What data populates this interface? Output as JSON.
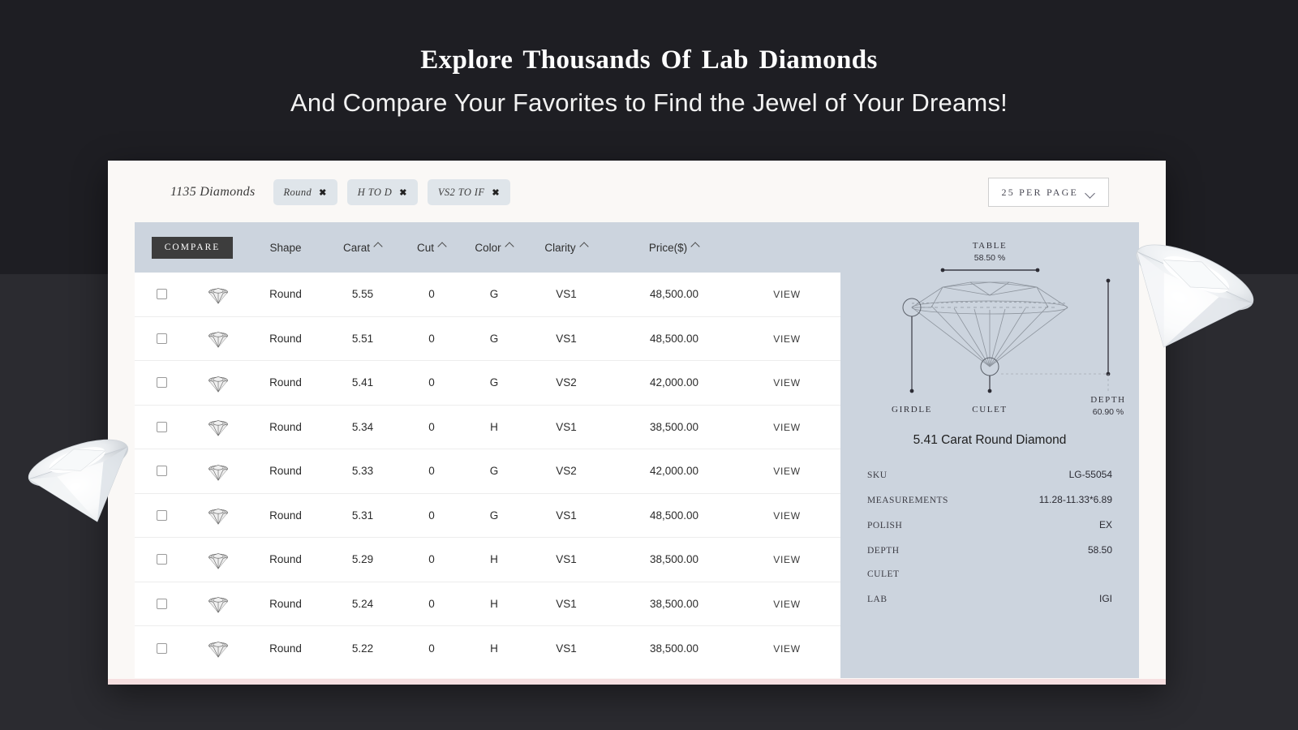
{
  "hero": {
    "title": "Explore  Thousands Of  Lab Diamonds",
    "subtitle": "And Compare Your Favorites to Find the Jewel of Your Dreams!"
  },
  "filterbar": {
    "count_label": "1135 Diamonds",
    "chips": [
      {
        "label": "Round",
        "remove": "✖"
      },
      {
        "label": "H TO D",
        "remove": "✖"
      },
      {
        "label": "VS2 TO IF",
        "remove": "✖"
      }
    ],
    "per_page": {
      "label": "25 PER PAGE",
      "icon": "chevron-down-icon"
    }
  },
  "table": {
    "compare_label": "COMPARE",
    "columns": [
      {
        "label": "",
        "sortable": false
      },
      {
        "label": "",
        "sortable": false
      },
      {
        "label": "Shape",
        "sortable": false
      },
      {
        "label": "Carat",
        "sortable": true
      },
      {
        "label": "Cut",
        "sortable": true
      },
      {
        "label": "Color",
        "sortable": true
      },
      {
        "label": "Clarity",
        "sortable": true
      },
      {
        "label": "Price($)",
        "sortable": true
      },
      {
        "label": "",
        "sortable": false
      }
    ],
    "view_label": "VIEW",
    "rows": [
      {
        "shape": "Round",
        "carat": "5.55",
        "cut": "0",
        "color": "G",
        "clarity": "VS1",
        "price": "48,500.00"
      },
      {
        "shape": "Round",
        "carat": "5.51",
        "cut": "0",
        "color": "G",
        "clarity": "VS1",
        "price": "48,500.00"
      },
      {
        "shape": "Round",
        "carat": "5.41",
        "cut": "0",
        "color": "G",
        "clarity": "VS2",
        "price": "42,000.00"
      },
      {
        "shape": "Round",
        "carat": "5.34",
        "cut": "0",
        "color": "H",
        "clarity": "VS1",
        "price": "38,500.00"
      },
      {
        "shape": "Round",
        "carat": "5.33",
        "cut": "0",
        "color": "G",
        "clarity": "VS2",
        "price": "42,000.00"
      },
      {
        "shape": "Round",
        "carat": "5.31",
        "cut": "0",
        "color": "G",
        "clarity": "VS1",
        "price": "48,500.00"
      },
      {
        "shape": "Round",
        "carat": "5.29",
        "cut": "0",
        "color": "H",
        "clarity": "VS1",
        "price": "38,500.00"
      },
      {
        "shape": "Round",
        "carat": "5.24",
        "cut": "0",
        "color": "H",
        "clarity": "VS1",
        "price": "38,500.00"
      },
      {
        "shape": "Round",
        "carat": "5.22",
        "cut": "0",
        "color": "H",
        "clarity": "VS1",
        "price": "38,500.00"
      }
    ]
  },
  "detail": {
    "title": "5.41 Carat Round Diamond",
    "diagram": {
      "table_label": "TABLE",
      "table_value": "58.50 %",
      "girdle_label": "GIRDLE",
      "culet_label": "CULET",
      "depth_label": "DEPTH",
      "depth_value": "60.90 %"
    },
    "specs": [
      {
        "key": "SKU",
        "value": "LG-55054"
      },
      {
        "key": "MEASUREMENTS",
        "value": "11.28-11.33*6.89"
      },
      {
        "key": "POLISH",
        "value": "EX"
      },
      {
        "key": "DEPTH",
        "value": "58.50"
      },
      {
        "key": "CULET",
        "value": ""
      },
      {
        "key": "LAB",
        "value": "IGI"
      }
    ]
  },
  "colors": {
    "page_bg": "#212126",
    "card_bg": "#faf8f6",
    "header_bg": "#ccd4de",
    "panel_bg": "#ccd4de",
    "chip_bg": "#dfe5ea",
    "compare_bg": "#3d3d3d",
    "accent_stripe": "#f6dfe0"
  }
}
